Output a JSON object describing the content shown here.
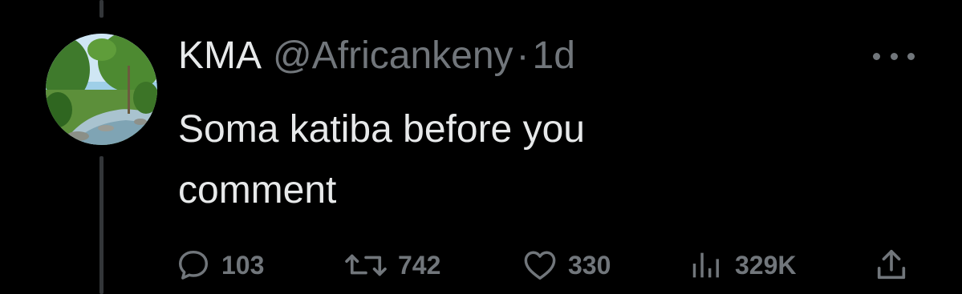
{
  "tweet": {
    "display_name": "KMA",
    "handle": "@Africankeny",
    "separator": "·",
    "timestamp": "1d",
    "text": "Soma katiba before you comment",
    "avatar_icon": "landscape-river-avatar"
  },
  "actions": {
    "reply": {
      "icon": "reply-icon",
      "count": "103"
    },
    "retweet": {
      "icon": "retweet-icon",
      "count": "742"
    },
    "like": {
      "icon": "heart-icon",
      "count": "330"
    },
    "views": {
      "icon": "views-chart-icon",
      "count": "329K"
    },
    "share": {
      "icon": "share-icon"
    }
  },
  "colors": {
    "background": "#000000",
    "primary_text": "#e7e9ea",
    "secondary_text": "#71767b",
    "thread_line": "#333639"
  }
}
